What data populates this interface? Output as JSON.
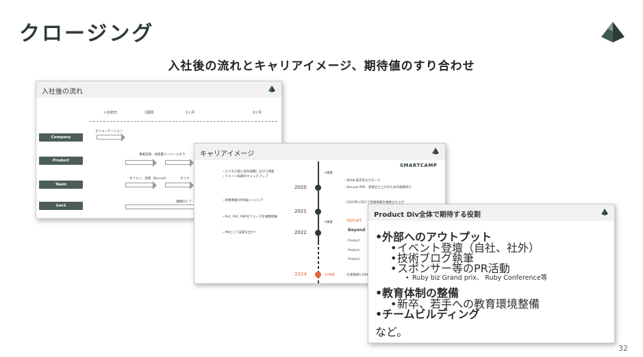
{
  "slide": {
    "title": "クロージング",
    "subtitle": "入社後の流れとキャリアイメージ、期待値のすり合わせ",
    "page_number": "32",
    "logo_icon": "pyramid-logo-icon"
  },
  "card1": {
    "header": "入社後の流れ",
    "periods": [
      "入社初日",
      "2週間",
      "1ヶ月",
      "2ヶ月"
    ],
    "labels": [
      "Company",
      "Product",
      "Team",
      "1on1"
    ],
    "texts": [
      "オリエンテーション",
      "事業説明、他部署メンバーとのラ",
      "オリエン、実務（Biscuet）",
      "オリエ",
      "課題のヒア"
    ]
  },
  "card2": {
    "header": "キャリアイメージ",
    "brand": "SMARTCAMP",
    "left_items": [
      "・ビジネス部と案件調整しながら開発",
      "・ドメイン知識のキャッチアップ",
      "・新規事業のPM兼エンジニア",
      "・PoC, PSF, PMFのフェーズを複数経験",
      "・PMとして成果を出す！"
    ],
    "years": [
      "2020",
      "2021",
      "2022",
      "2024"
    ],
    "right_items": [
      "4事業",
      "・BOXIL安定的なグロース",
      "・Biscuet PMF、新規立ち上げのための組織作り",
      "・2024年に向けて新規事業を複数立ち上げ",
      "6事業",
      "Product",
      "Product",
      "Product",
      "10事業",
      "・企業価値1,000"
    ],
    "logos": [
      "Sqmart",
      "Beyond"
    ]
  },
  "card3": {
    "header": "Product Div全体で期待する役割",
    "items": [
      {
        "level": 1,
        "text": "外部へのアウトプット"
      },
      {
        "level": 2,
        "text": "イベント登壇（自社、社外）"
      },
      {
        "level": 2,
        "text": "技術ブログ執筆"
      },
      {
        "level": 2,
        "text": "スポンサー等のPR活動"
      },
      {
        "level": 3,
        "text": "Ruby biz Grand prix、 Ruby Conference等"
      },
      {
        "level": 1,
        "text": "教育体制の整備"
      },
      {
        "level": 2,
        "text": "新卒、若手への教育環境整備"
      },
      {
        "level": 1,
        "text": "チームビルディング"
      },
      {
        "level": 0,
        "text": "など。"
      }
    ]
  },
  "colors": {
    "accent": "#e8623a",
    "dark": "#2e3a36",
    "label_bg": "#4d5e59"
  }
}
